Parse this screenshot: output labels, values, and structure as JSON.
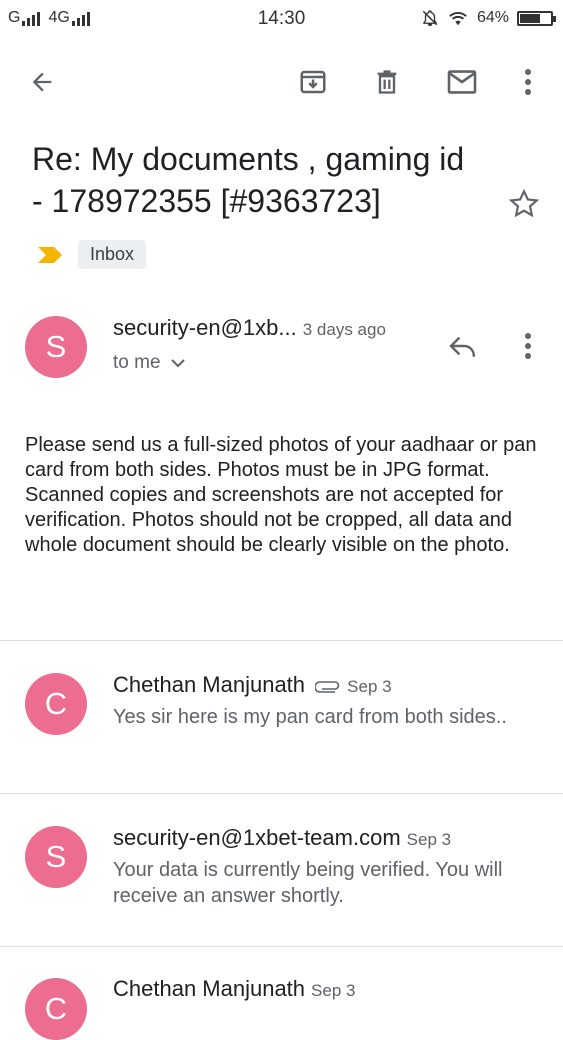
{
  "status_bar": {
    "left_text": "G",
    "network": "4G",
    "time": "14:30",
    "battery": "64%",
    "battery_level": 0.64
  },
  "toolbar": {
    "back": "back-arrow-icon",
    "archive": "archive-icon",
    "delete": "trash-icon",
    "mark_unread": "mail-icon",
    "more": "more-vert-icon"
  },
  "email": {
    "subject": "Re: My documents , gaming id - 178972355 [#9363723]",
    "label": "Inbox",
    "important_color": "#f4b400"
  },
  "messages": [
    {
      "avatar": "S",
      "sender": "security-en@1xb...",
      "date": "3 days ago",
      "recipient": "to me",
      "body": [
        "Please send us a full-sized photos of your aadhaar or pan card from both sides. Photos must be in JPG format.",
        "Scanned copies and screenshots are not accepted for verification. Photos should not be cropped, all data and whole document should be clearly visible on the photo."
      ]
    },
    {
      "avatar": "C",
      "sender": "Chethan Manjunath",
      "date": "Sep 3",
      "snippet": "Yes sir here is my pan card from both sides.."
    },
    {
      "avatar": "S",
      "sender": "security-en@1xbet-team.com",
      "date": "Sep 3",
      "snippet": "Your data is currently being verified. You will receive an answer shortly."
    },
    {
      "avatar": "C",
      "sender": "Chethan Manjunath",
      "date": "Sep 3"
    }
  ],
  "colors": {
    "avatar_bg": "#ec6d90"
  }
}
